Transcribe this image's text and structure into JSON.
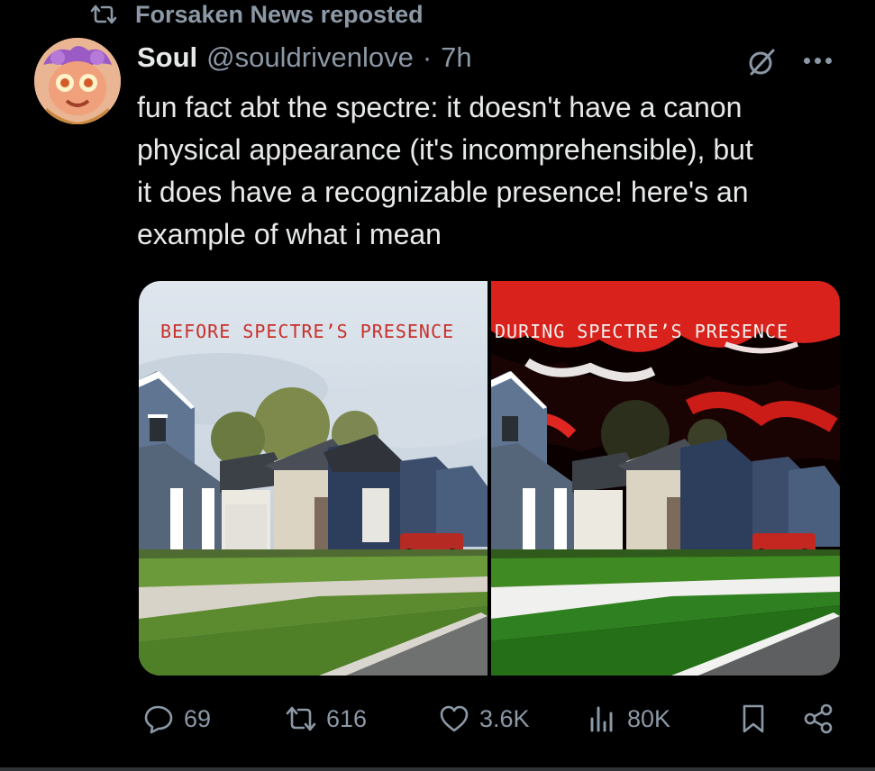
{
  "repost": {
    "label": "Forsaken News reposted",
    "icon": "repost-icon"
  },
  "author": {
    "name": "Soul",
    "handle": "@souldrivenlove",
    "separator": "·",
    "time": "7h"
  },
  "tweet": {
    "lines": [
      "fun fact abt the spectre: it doesn't have a canon",
      "physical appearance (it's incomprehensible), but",
      "it does have a recognizable presence! here's an",
      "example of what i mean"
    ]
  },
  "media": {
    "before_caption": "BEFORE SPECTRE’S PRESENCE",
    "during_caption": "DURING SPECTRE’S PRESENCE"
  },
  "actions": {
    "replies": "69",
    "reposts": "616",
    "likes": "3.6K",
    "views": "80K"
  },
  "colors": {
    "background": "#000000",
    "secondary_text": "#8b98a5",
    "primary_text": "#e7e9ea",
    "caption_red": "#c8302a"
  }
}
